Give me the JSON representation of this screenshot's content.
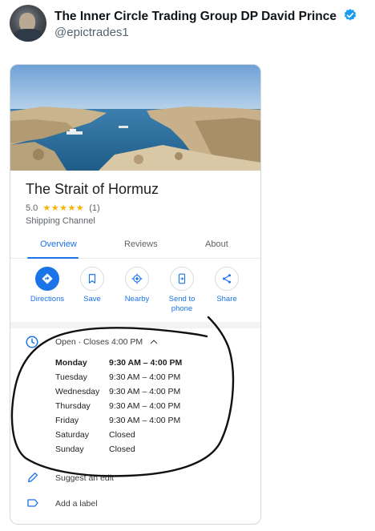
{
  "tweet": {
    "display_name": "The Inner Circle Trading Group DP David Prince",
    "handle": "@epictrades1",
    "avatar_icon": "profile-photo",
    "verified_icon": "verified-badge-icon",
    "accent_color": "#1d9bf0"
  },
  "place": {
    "name": "The Strait of Hormuz",
    "rating": "5.0",
    "stars": "★★★★★",
    "review_count": "(1)",
    "category": "Shipping Channel"
  },
  "tabs": [
    {
      "label": "Overview",
      "active": true
    },
    {
      "label": "Reviews",
      "active": false
    },
    {
      "label": "About",
      "active": false
    }
  ],
  "actions": [
    {
      "label": "Directions",
      "icon": "directions-icon"
    },
    {
      "label": "Save",
      "icon": "bookmark-icon"
    },
    {
      "label": "Nearby",
      "icon": "nearby-icon"
    },
    {
      "label": "Send to phone",
      "icon": "send-to-phone-icon"
    },
    {
      "label": "Share",
      "icon": "share-icon"
    }
  ],
  "hours": {
    "status": "Open · Closes 4:00 PM",
    "days": [
      {
        "day": "Monday",
        "time": "9:30 AM – 4:00 PM"
      },
      {
        "day": "Tuesday",
        "time": "9:30 AM – 4:00 PM"
      },
      {
        "day": "Wednesday",
        "time": "9:30 AM – 4:00 PM"
      },
      {
        "day": "Thursday",
        "time": "9:30 AM – 4:00 PM"
      },
      {
        "day": "Friday",
        "time": "9:30 AM – 4:00 PM"
      },
      {
        "day": "Saturday",
        "time": "Closed"
      },
      {
        "day": "Sunday",
        "time": "Closed"
      }
    ]
  },
  "links": {
    "suggest_edit": "Suggest an edit",
    "add_label": "Add a label"
  },
  "colors": {
    "google_blue": "#1a73e8",
    "star_yellow": "#f4b400",
    "sea": "#2f6f9c"
  }
}
